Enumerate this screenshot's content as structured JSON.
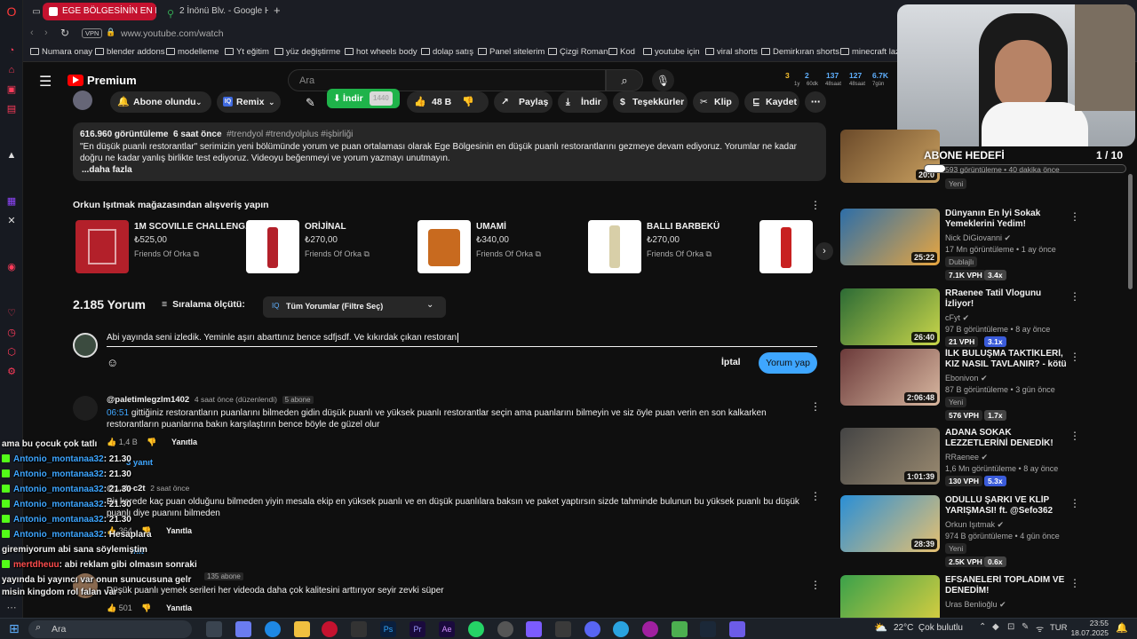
{
  "browser": {
    "tabs": [
      {
        "label": "EGE BÖLGESİNİN EN DÜŞ",
        "active": true
      },
      {
        "label": "2 İnönü Blv. - Google Har",
        "active": false
      }
    ],
    "new_tab": "+",
    "vpn": "VPN",
    "url": "www.youtube.com/watch",
    "bookmarks": [
      "Numara onay",
      "blender addons",
      "modelleme",
      "Yt eğitim",
      "yüz değiştirme",
      "hot wheels body",
      "dolap satış",
      "Panel sitelerim",
      "Çizgi Roman",
      "Kod",
      "youtube için",
      "viral shorts",
      "Demirkıran shorts",
      "minecraft laz"
    ]
  },
  "yt": {
    "logo": "Premium",
    "search_placeholder": "Ara",
    "stats": [
      "3",
      "2",
      "137",
      "127",
      "6.7K",
      "1y",
      "60dk",
      "48saat",
      "48saat",
      "7gün"
    ]
  },
  "actions": {
    "subscribed": "Abone olundu",
    "remix": "Remix",
    "download": "İndir",
    "quality": "1440",
    "likes": "48 B",
    "share": "Paylaş",
    "download2": "İndir",
    "thanks": "Teşekkürler",
    "clip": "Klip",
    "save": "Kaydet"
  },
  "description": {
    "views": "616.960 görüntüleme",
    "time": "6 saat önce",
    "tags": "#trendyol #trendyolplus #işbirliği",
    "text": "\"En düşük puanlı restorantlar\" serimizin yeni bölümünde yorum ve puan ortalaması olarak Ege Bölgesinin en düşük puanlı restorantlarını gezmeye devam ediyoruz. Yorumlar ne kadar doğru ne kadar yanlış birlikte test ediyoruz. Videoyu beğenmeyi ve yorum yazmayı unutmayın.",
    "more": "...daha fazla"
  },
  "shop": {
    "title": "Orkun Işıtmak mağazasından alışveriş yapın",
    "products": [
      {
        "name": "1M SCOVILLE CHALLENG...",
        "price": "₺525,00",
        "seller": "Friends Of Orka"
      },
      {
        "name": "ORİJİNAL",
        "price": "₺270,00",
        "seller": "Friends Of Orka"
      },
      {
        "name": "UMAMİ",
        "price": "₺340,00",
        "seller": "Friends Of Orka"
      },
      {
        "name": "BALLI BARBEKÜ",
        "price": "₺270,00",
        "seller": "Friends Of Orka"
      },
      {
        "name": "SF",
        "price": "",
        "seller": ""
      }
    ]
  },
  "comments": {
    "count": "2.185 Yorum",
    "sort_label": "Sıralama ölçütü:",
    "filter": "Tüm Yorumlar (Filtre Seç)",
    "draft": "Abi yayında seni izledik. Yeminle aşırı abarttınız bence sdfjsdf. Ve kıkırdak çıkan restoran",
    "cancel": "İptal",
    "submit": "Yorum yap",
    "items": [
      {
        "author": "@paletimlegzlm1402",
        "time": "4 saat önce (düzenlendi)",
        "badge": "5 abone",
        "timestamp": "06:51",
        "text": "gittiğiniz restorantların puanlarını bilmeden gidin düşük puanlı ve yüksek puanlı restorantlar seçin ama puanlarını bilmeyin ve siz öyle puan verin en son kalkarken restorantların puanlarına bakın karşılaştırın bence böyle de güzel olur",
        "likes": "1,4 B",
        "reply": "Yanıtla",
        "replies": "3 yanıt"
      },
      {
        "author": "@...rb-c2t",
        "time": "2 saat önce",
        "text": "Bir kerede kaç puan olduğunu bilmeden yiyin mesala ekip en yüksek puanlı ve en düşük puanlılara baksın ve paket yaptırsın sizde tahminde bulunun bu yüksek puanlı bu düşük puanlı diye puanını bilmeden",
        "likes": "364",
        "reply": "Yanıtla",
        "replies": "nıt"
      },
      {
        "badge": "135 abone",
        "text": "Düşük puanlı yemek serileri her videoda daha çok kalitesini arttırıyor seyir zevki süper",
        "likes": "501",
        "reply": "Yanıtla"
      }
    ]
  },
  "chat": [
    {
      "name": "",
      "text": "ama bu çocuk çok tatlı"
    },
    {
      "name": "Antonio_montanaa32",
      "text": ": 21.30"
    },
    {
      "name": "Antonio_montanaa32",
      "text": ": 21.30"
    },
    {
      "name": "Antonio_montanaa32",
      "text": ": 21.30"
    },
    {
      "name": "Antonio_montanaa32",
      "text": ": 21.30"
    },
    {
      "name": "Antonio_montanaa32",
      "text": ": 21.30"
    },
    {
      "name": "Antonio_montanaa32",
      "text": ": Hesaplara"
    },
    {
      "name": "",
      "text": "giremiyorum abi sana söylemiştim"
    },
    {
      "name": "mertdheuu",
      "text": ": abi reklam gibi olmasın sonraki"
    },
    {
      "name": "",
      "text": "yayında bi yayıncı var onun sunucusuna gelr"
    },
    {
      "name": "",
      "text": "misin kingdom rol falan var"
    }
  ],
  "overlay": {
    "goal": "ABONE HEDEFİ",
    "progress": "1 / 10",
    "progress_fraction": 0.1
  },
  "recommended": [
    {
      "title": "Dünyanın En İyi Sokak Yemeklerini Yedim!",
      "channel": "Nick DiGiovanni",
      "meta": "17 Mn görüntüleme • 1 ay önce",
      "duration": "25:22",
      "tag": "Dublajlı",
      "stat1": "7.1K VPH",
      "stat2": "3.4x",
      "c1": "#2d6ea8",
      "c2": "#e8a640"
    },
    {
      "title": "RRaenee Tatil Vlogunu İzliyor!",
      "channel": "cFyt",
      "meta": "97 B görüntüleme • 8 ay önce",
      "duration": "26:40",
      "stat1": "21 VPH",
      "stat2": "3.1x",
      "c1": "#2c6b35",
      "c2": "#c9d64a"
    },
    {
      "title": "İLK BULUŞMA TAKTİKLERİ, KIZ NASIL TAVLANIR? - kötü yola ...",
      "channel": "Ebonivon",
      "meta": "87 B görüntüleme • 3 gün önce",
      "duration": "2:06:48",
      "tag": "Yeni",
      "stat1": "576 VPH",
      "stat2": "1.7x",
      "c1": "#6b3a3a",
      "c2": "#d8b7a0"
    },
    {
      "title": "ADANA SOKAK LEZZETLERİNİ DENEDİK!",
      "channel": "RRaenee",
      "meta": "1,6 Mn görüntüleme • 8 ay önce",
      "duration": "1:01:39",
      "stat1": "130 VPH",
      "stat2": "5.3x",
      "c1": "#444",
      "c2": "#9a8a70"
    },
    {
      "title": "ÖDÜLLÜ ŞARKI VE KLİP YARIŞMASI! ft. @Sefo362",
      "channel": "Orkun Işıtmak",
      "meta": "974 B görüntüleme • 4 gün önce",
      "duration": "28:39",
      "tag": "Yeni",
      "stat1": "2.5K VPH",
      "stat2": "0.6x",
      "c1": "#2a8fd6",
      "c2": "#e6c070"
    },
    {
      "title": "EFSANELERİ TOPLADIM VE DENEDİM!",
      "channel": "Uras Benlioğlu",
      "meta": "",
      "duration": "",
      "c1": "#3aa14a",
      "c2": "#e0d040"
    }
  ],
  "top_video": {
    "meta": "593 görüntüleme • 40 dakika önce",
    "tag": "Yeni",
    "duration": "20:0"
  },
  "taskbar": {
    "search": "Ara",
    "weather_temp": "22°C",
    "weather_text": "Çok bulutlu",
    "lang": "TUR",
    "time": "23:55",
    "date": "18.07.2025"
  }
}
